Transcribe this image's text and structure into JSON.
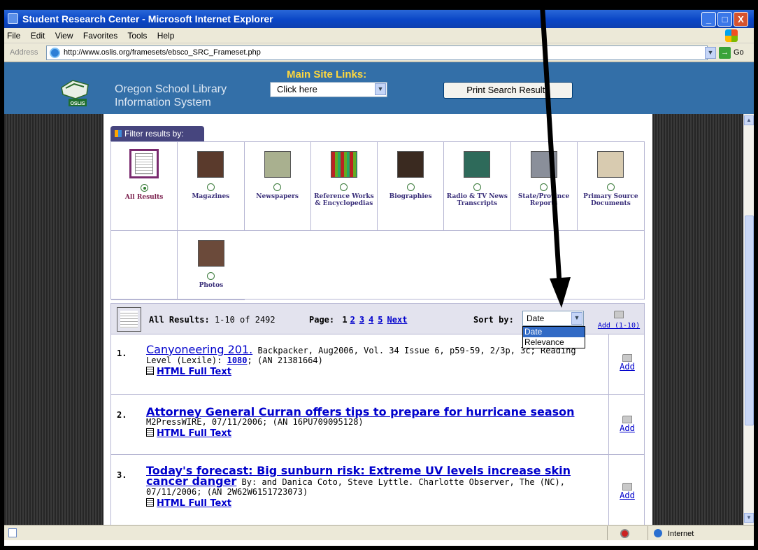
{
  "window": {
    "title": "Student Research Center - Microsoft Internet Explorer",
    "controls": [
      "_",
      "□",
      "X"
    ]
  },
  "menu": [
    "File",
    "Edit",
    "View",
    "Favorites",
    "Tools",
    "Help"
  ],
  "address": {
    "label": "Address",
    "url": "http://www.oslis.org/framesets/ebsco_SRC_Frameset.php",
    "go": "Go"
  },
  "banner": {
    "logo_text": "OSLIS",
    "org_line1": "Oregon School Library",
    "org_line2": "Information System",
    "main_links_label": "Main Site Links:",
    "main_links_value": "Click here",
    "print_button": "Print Search Results"
  },
  "filter": {
    "tab_label": "Filter results by:",
    "options": [
      {
        "label": "All Results",
        "selected": true
      },
      {
        "label": "Magazines",
        "selected": false
      },
      {
        "label": "Newspapers",
        "selected": false
      },
      {
        "label": "Reference Works & Encyclopedias",
        "selected": false
      },
      {
        "label": "Biographies",
        "selected": false
      },
      {
        "label": "Radio & TV News Transcripts",
        "selected": false
      },
      {
        "label": "State/Province Reports",
        "selected": false
      },
      {
        "label": "Primary Source Documents",
        "selected": false
      },
      {
        "label": "Photos",
        "selected": false
      }
    ]
  },
  "results_bar": {
    "label": "All Results:",
    "range": "1-10 of 2492",
    "page_label": "Page:",
    "current_page": "1",
    "pages": [
      "2",
      "3",
      "4",
      "5"
    ],
    "next": "Next",
    "sort_label": "Sort by:",
    "sort_value": "Date",
    "sort_options": [
      "Date",
      "Relevance"
    ],
    "add_range": "Add (1-10)"
  },
  "results": [
    {
      "num": "1.",
      "title": "Canyoneering 201.",
      "meta_a": "Backpacker, Aug2006, Vol. 34 Issue 6, p59-59, 2/3p, 3c; Reading Level (Lexile): ",
      "lexile": "1080",
      "meta_b": "; (AN 21381664)",
      "full_text": "HTML Full Text",
      "add": "Add"
    },
    {
      "num": "2.",
      "title": "Attorney General Curran offers tips to prepare for hurricane season",
      "meta_a": "M2PressWIRE, 07/11/2006; (AN 16PU709095128)",
      "full_text": "HTML Full Text",
      "add": "Add"
    },
    {
      "num": "3.",
      "title": "Today's forecast: Big sunburn risk: Extreme UV levels increase skin cancer danger",
      "meta_a": " By: and Danica Coto, Steve Lyttle. Charlotte Observer, The (NC), 07/11/2006; (AN 2W62W6151723073)",
      "full_text": "HTML Full Text",
      "add": "Add"
    }
  ],
  "status": {
    "zone": "Internet"
  }
}
